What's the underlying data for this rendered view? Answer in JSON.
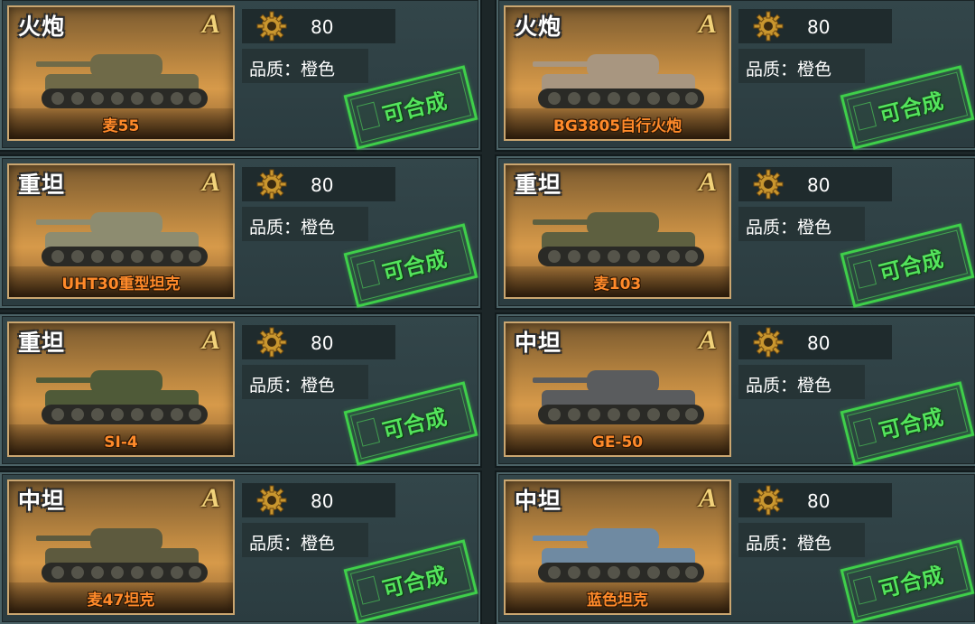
{
  "cards": [
    {
      "type_label": "火炮",
      "grade": "A",
      "name": "麦55",
      "cost": "80",
      "quality": "品质：橙色",
      "stamp": "可合成",
      "icon": "gear-icon",
      "tank_color": "#6f6a48"
    },
    {
      "type_label": "火炮",
      "grade": "A",
      "name": "BG3805自行火炮",
      "cost": "80",
      "quality": "品质：橙色",
      "stamp": "可合成",
      "icon": "gear-icon",
      "tank_color": "#a89680"
    },
    {
      "type_label": "重坦",
      "grade": "A",
      "name": "UHT30重型坦克",
      "cost": "80",
      "quality": "品质：橙色",
      "stamp": "可合成",
      "icon": "gear-icon",
      "tank_color": "#8d8c70"
    },
    {
      "type_label": "重坦",
      "grade": "A",
      "name": "麦103",
      "cost": "80",
      "quality": "品质：橙色",
      "stamp": "可合成",
      "icon": "gear-icon",
      "tank_color": "#5e6040"
    },
    {
      "type_label": "重坦",
      "grade": "A",
      "name": "SI-4",
      "cost": "80",
      "quality": "品质：橙色",
      "stamp": "可合成",
      "icon": "gear-icon",
      "tank_color": "#4f5a38"
    },
    {
      "type_label": "中坦",
      "grade": "A",
      "name": "GE-50",
      "cost": "80",
      "quality": "品质：橙色",
      "stamp": "可合成",
      "icon": "gear-icon",
      "tank_color": "#5a5c5e"
    },
    {
      "type_label": "中坦",
      "grade": "A",
      "name": "麦47坦克",
      "cost": "80",
      "quality": "品质：橙色",
      "stamp": "可合成",
      "icon": "gear-icon",
      "tank_color": "#5d5a3e"
    },
    {
      "type_label": "中坦",
      "grade": "A",
      "name": "蓝色坦克",
      "cost": "80",
      "quality": "品质：橙色",
      "stamp": "可合成",
      "icon": "gear-icon",
      "tank_color": "#6f8aa2"
    }
  ]
}
